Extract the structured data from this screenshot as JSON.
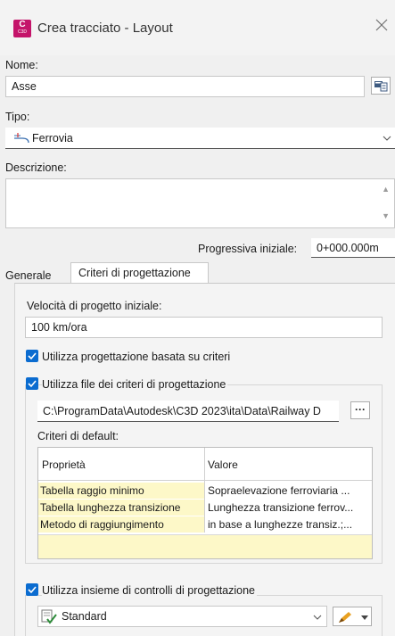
{
  "window": {
    "title": "Crea tracciato - Layout",
    "app_icon": {
      "letter": "C",
      "sub": "C3D"
    }
  },
  "nome": {
    "label": "Nome:",
    "value": "Asse"
  },
  "tipo": {
    "label": "Tipo:",
    "value": "Ferrovia"
  },
  "descrizione": {
    "label": "Descrizione:",
    "value": ""
  },
  "progressiva": {
    "label": "Progressiva iniziale:",
    "value": "0+000.000m"
  },
  "tabs": [
    {
      "label": "Generale"
    },
    {
      "label": "Criteri di progettazione"
    }
  ],
  "velocita": {
    "label": "Velocità di progetto iniziale:",
    "value": "100 km/ora"
  },
  "checks": {
    "basata_criteri": {
      "label": "Utilizza progettazione basata su criteri",
      "checked": true
    },
    "file_criteri": {
      "label": "Utilizza file dei criteri di progettazione",
      "checked": true
    },
    "insieme_controlli": {
      "label": "Utilizza insieme di controlli di progettazione",
      "checked": true
    }
  },
  "file_path": {
    "value": "C:\\ProgramData\\Autodesk\\C3D 2023\\ita\\Data\\Railway D",
    "browse_label": "···"
  },
  "criteri_default": {
    "label": "Criteri di default:",
    "columns": [
      "Proprietà",
      "Valore"
    ],
    "rows": [
      [
        "Tabella raggio minimo",
        "Sopraelevazione ferroviaria ..."
      ],
      [
        "Tabella lunghezza transizione",
        "Lunghezza transizione ferrov..."
      ],
      [
        "Metodo di raggiungimento",
        "in base a lunghezze transiz.;..."
      ]
    ]
  },
  "controlli": {
    "value": "Standard"
  },
  "colors": {
    "accent": "#0b6cd0",
    "app_icon": "#c4146a",
    "row_highlight": "#fdf8c8"
  }
}
